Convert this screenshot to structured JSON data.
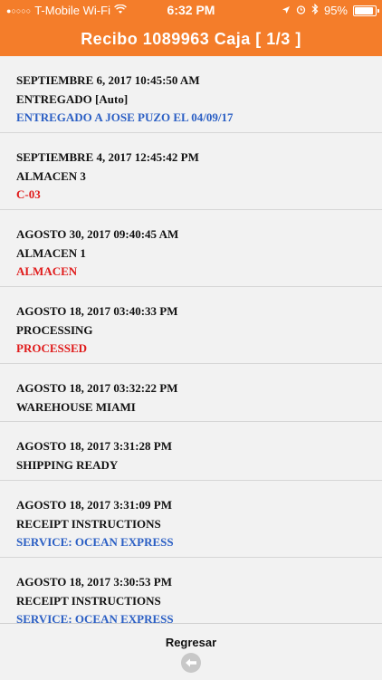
{
  "status_bar": {
    "signal": "●○○○○",
    "carrier": "T-Mobile Wi-Fi",
    "time": "6:32 PM",
    "battery": "95%",
    "battery_level": 0.95
  },
  "header": {
    "title": "Recibo 1089963 Caja [ 1/3 ]",
    "background": "#f47d2a"
  },
  "entries": [
    {
      "date": "SEPTIEMBRE 6, 2017 10:45:50 AM",
      "status": "ENTREGADO [Auto]",
      "detail": "ENTREGADO A JOSE PUZO EL 04/09/17",
      "detail_color": "blue"
    },
    {
      "date": "SEPTIEMBRE 4, 2017 12:45:42 PM",
      "status": "ALMACEN 3",
      "detail": "C-03",
      "detail_color": "red"
    },
    {
      "date": "AGOSTO 30, 2017 09:40:45 AM",
      "status": "ALMACEN 1",
      "detail": "ALMACEN",
      "detail_color": "red"
    },
    {
      "date": "AGOSTO 18, 2017 03:40:33 PM",
      "status": "PROCESSING",
      "detail": "PROCESSED",
      "detail_color": "red"
    },
    {
      "date": "AGOSTO 18, 2017 03:32:22 PM",
      "status": "WAREHOUSE MIAMI",
      "detail": "",
      "detail_color": ""
    },
    {
      "date": "AGOSTO 18, 2017 3:31:28 PM",
      "status": "SHIPPING READY",
      "detail": "",
      "detail_color": ""
    },
    {
      "date": "AGOSTO 18, 2017 3:31:09 PM",
      "status": "RECEIPT INSTRUCTIONS",
      "detail": "SERVICE: OCEAN EXPRESS",
      "detail_color": "blue"
    },
    {
      "date": "AGOSTO 18, 2017 3:30:53 PM",
      "status": "RECEIPT INSTRUCTIONS",
      "detail": "SERVICE: OCEAN EXPRESS",
      "detail_color": "blue"
    }
  ],
  "footer": {
    "back_label": "Regresar",
    "back_icon": "arrow-left-circle-icon"
  },
  "colors": {
    "blue": "#2b5fc4",
    "red": "#e01b1b"
  }
}
